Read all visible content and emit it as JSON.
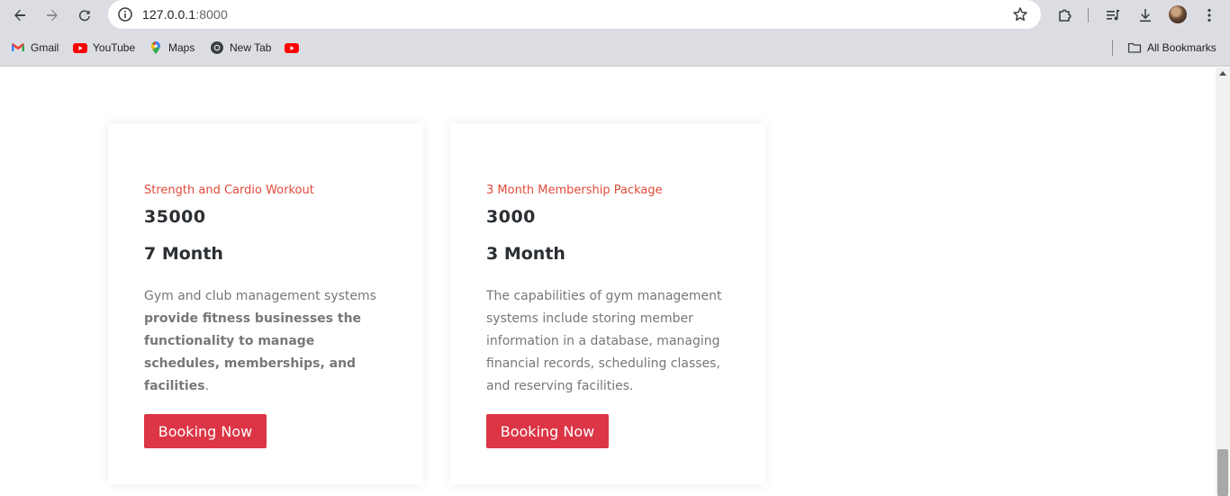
{
  "browser": {
    "url_host": "127.0.0.1",
    "url_port": ":8000",
    "bookmarks": [
      {
        "label": "Gmail",
        "icon": "gmail-icon"
      },
      {
        "label": "YouTube",
        "icon": "youtube-icon"
      },
      {
        "label": "Maps",
        "icon": "maps-icon"
      },
      {
        "label": "New Tab",
        "icon": "chrome-icon"
      },
      {
        "label": "",
        "icon": "youtube-icon"
      }
    ],
    "all_bookmarks": "All Bookmarks"
  },
  "packages": [
    {
      "subtitle": "Strength and Cardio Workout",
      "price": "35000",
      "duration": "7 Month",
      "desc_plain_1": "Gym and club management systems ",
      "desc_bold": "provide fitness businesses the functionality to manage schedules, memberships, and facilities",
      "desc_plain_2": ".",
      "button": "Booking Now"
    },
    {
      "subtitle": "3 Month Membership Package",
      "price": "3000",
      "duration": "3 Month",
      "desc_plain_1": "The capabilities of gym management systems include storing member information in a database, managing financial records, scheduling classes, and reserving facilities.",
      "desc_bold": "",
      "desc_plain_2": "",
      "button": "Booking Now"
    }
  ],
  "colors": {
    "accent_red": "#dc3545",
    "subtitle_red": "#e04a3a"
  }
}
